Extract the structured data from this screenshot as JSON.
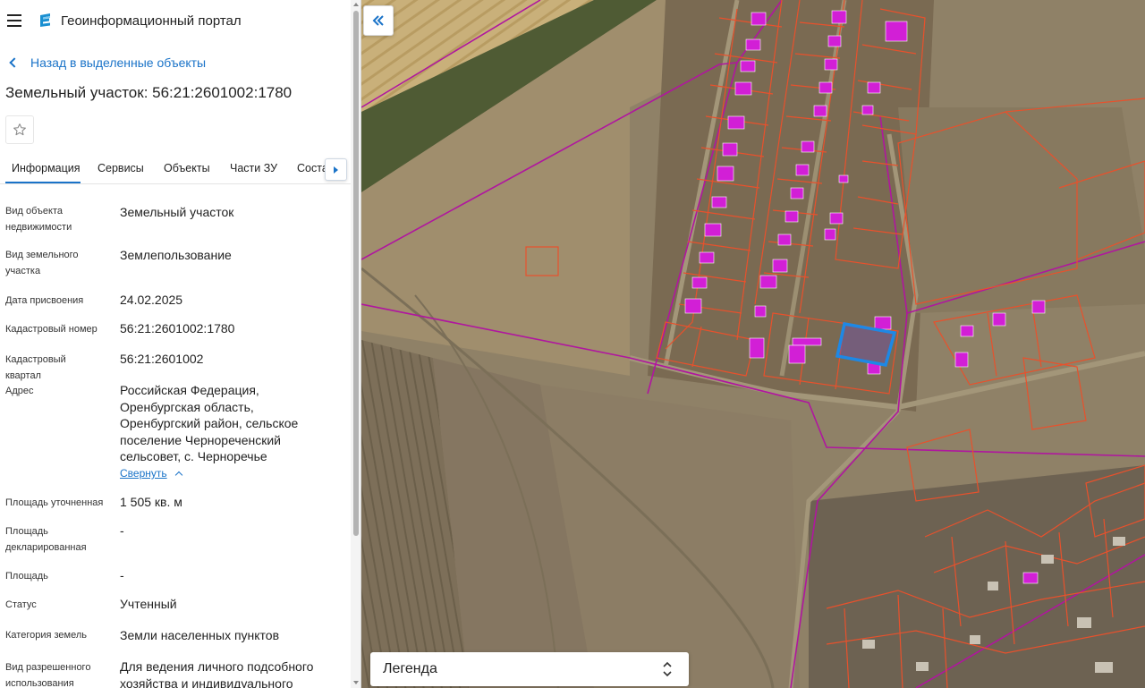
{
  "app": {
    "title": "Геоинформационный портал"
  },
  "nav": {
    "back_label": "Назад в выделенные объекты"
  },
  "object": {
    "title": "Земельный участок: 56:21:2601002:1780"
  },
  "tabs": [
    {
      "label": "Информация",
      "active": true
    },
    {
      "label": "Сервисы",
      "active": false
    },
    {
      "label": "Объекты",
      "active": false
    },
    {
      "label": "Части ЗУ",
      "active": false
    },
    {
      "label": "Состав ПЗ",
      "active": false
    }
  ],
  "properties": [
    {
      "label": "Вид объекта недвижимости",
      "value": "Земельный участок"
    },
    {
      "label": "Вид земельного участка",
      "value": "Землепользование"
    },
    {
      "label": "Дата присвоения",
      "value": "24.02.2025"
    },
    {
      "label": "Кадастровый номер",
      "value": "56:21:2601002:1780"
    },
    {
      "label": "Кадастровый квартал",
      "value": "56:21:2601002"
    },
    {
      "label": "Адрес",
      "value": "Российская Федерация, Оренбургская область, Оренбургский район, сельское поселение Чернореченский сельсовет, с. Черноречье"
    },
    {
      "label": "Площадь уточненная",
      "value": "1 505 кв. м"
    },
    {
      "label": "Площадь декларированная",
      "value": "-"
    },
    {
      "label": "Площадь",
      "value": "-"
    },
    {
      "label": "Статус",
      "value": "Учтенный"
    },
    {
      "label": "Категория земель",
      "value": "Земли населенных пунктов"
    },
    {
      "label": "Вид разрешенного использования",
      "value": "Для ведения личного подсобного хозяйства и индивидуального"
    }
  ],
  "address_toggle_label": "Свернуть",
  "legend": {
    "label": "Легенда"
  },
  "icons": {
    "menu": "hamburger-icon",
    "logo": "portal-logo-icon",
    "back": "chevron-left-icon",
    "favorite": "star-outline-icon",
    "tabs_next": "triangle-right-icon",
    "panel_collapse": "double-chevron-left-icon",
    "legend_toggle": "chevron-up-down-icon"
  },
  "colors": {
    "accent": "#1a73c8",
    "parcel_border": "#e8512c",
    "boundary": "#b0169f",
    "selected_parcel": "#1e88e5",
    "building_roof": "#d21fd6"
  }
}
